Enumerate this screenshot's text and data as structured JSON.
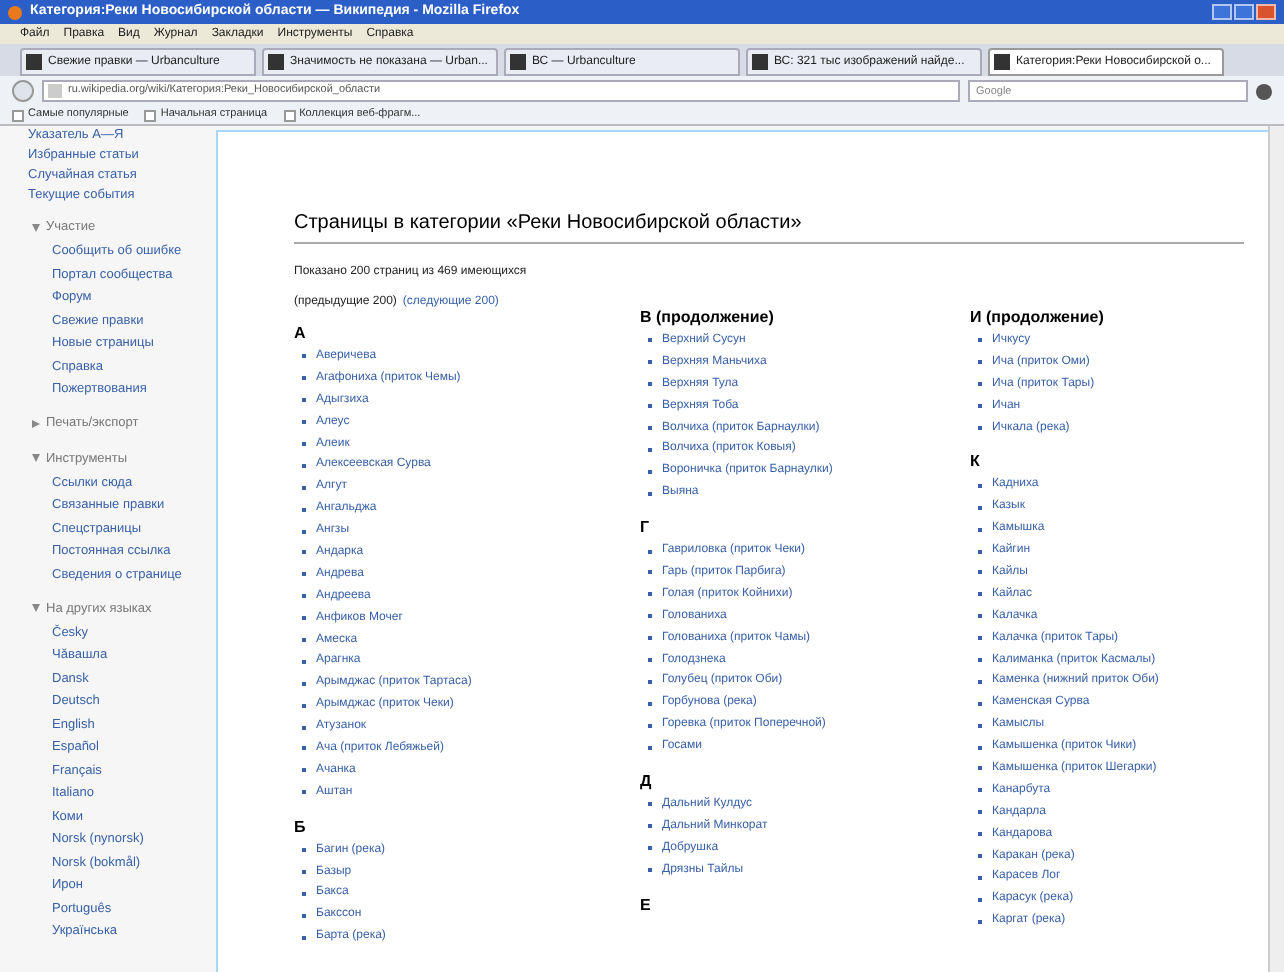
{
  "window": {
    "title": "Категория:Реки Новосибирской области — Википедия - Mozilla Firefox"
  },
  "menu": [
    "Файл",
    "Правка",
    "Вид",
    "Журнал",
    "Закладки",
    "Инструменты",
    "Справка"
  ],
  "tabs": [
    {
      "label": "Свежие правки — Urbanculture",
      "selected": false
    },
    {
      "label": "Значимость не показана — Urban...",
      "selected": false
    },
    {
      "label": "ВС — Urbanculture",
      "selected": false
    },
    {
      "label": "ВС: 321 тыс изображений найде...",
      "selected": false
    },
    {
      "label": "Категория:Реки Новосибирской о...",
      "selected": true
    }
  ],
  "address_bar": {
    "value": "ru.wikipedia.org/wiki/Категория:Реки_Новосибирской_области"
  },
  "search": {
    "placeholder": "Google"
  },
  "bookmarks": [
    "Самые популярные",
    "Начальная страница",
    "Коллекция веб-фрагм..."
  ],
  "sidebar": {
    "links": [
      "Указатель А—Я",
      "Избранные статьи",
      "Случайная статья",
      "Текущие события"
    ],
    "sections": [
      {
        "title": "Участие",
        "expanded": true,
        "items": [
          "Сообщить об ошибке",
          "Портал сообщества",
          "Форум",
          "Свежие правки",
          "Новые страницы",
          "Справка",
          "Пожертвования"
        ]
      },
      {
        "title": "Печать/экспорт",
        "expanded": false
      },
      {
        "title": "Инструменты",
        "expanded": true,
        "items": [
          "Ссылки сюда",
          "Связанные правки",
          "Спецстраницы",
          "Постоянная ссылка",
          "Сведения о странице"
        ]
      },
      {
        "title": "На других языках",
        "expanded": true,
        "items": [
          "Česky",
          "Чăвашла",
          "Dansk",
          "Deutsch",
          "English",
          "Español",
          "Français",
          "Italiano",
          "Коми",
          "Norsk (nynorsk)",
          "Norsk (bokmål)",
          "Ирон",
          "Português",
          "Українська"
        ]
      }
    ]
  },
  "content": {
    "heading": "Страницы в категории «Реки Новосибирской области»",
    "summary": "Показано 200 страниц из 469 имеющихся",
    "prev": "(предыдущие 200)",
    "next": "(следующие 200)",
    "columns": [
      [
        {
          "letter": "А",
          "items": [
            "Аверичева",
            "Агафониха (приток Чемы)",
            "Адыгзиха",
            "Алеус",
            "Алеик",
            "Алексеевская Сурва",
            "Алгут",
            "Ангальджа",
            "Ангзы",
            "Андарка",
            "Андрева",
            "Андреева",
            "Анфиков Мочег",
            "Амеска",
            "Арагнка",
            "Арымджас (приток Тартаса)",
            "Арымджас (приток Чеки)",
            "Атузанок",
            "Ача (приток Лебяжьей)",
            "Ачанка",
            "Аштан"
          ]
        },
        {
          "letter": "Б",
          "items": [
            "Багин (река)",
            "Базыр",
            "Бакса",
            "Бакссон",
            "Барта (река)"
          ]
        }
      ],
      [
        {
          "letter": "В (продолжение)",
          "items": [
            "Верхний Сусун",
            "Верхняя Маньчиха",
            "Верхняя Тула",
            "Верхняя Тоба",
            "Волчиха (приток Барнаулки)",
            "Волчиха (приток Ковыя)",
            "Вороничка (приток Барнаулки)",
            "Выяна"
          ]
        },
        {
          "letter": "Г",
          "items": [
            "Гавриловка (приток Чеки)",
            "Гарь (приток Парбига)",
            "Голая (приток Койнихи)",
            "Голованиха",
            "Голованиха (приток Чамы)",
            "Голодзнека",
            "Голубец (приток Оби)",
            "Горбунова (река)",
            "Горевка (приток Поперечной)",
            "Госами"
          ]
        },
        {
          "letter": "Д",
          "items": [
            "Дальний Кулдус",
            "Дальний Минкорат",
            "Добрушка",
            "Дрязны Тайлы"
          ]
        },
        {
          "letter": "Е"
        }
      ],
      [
        {
          "letter": "И (продолжение)",
          "items": [
            "Ичкусу",
            "Ича (приток Оми)",
            "Ича (приток Тары)",
            "Ичан",
            "Ичкала (река)"
          ]
        },
        {
          "letter": "К",
          "items": [
            "Кадниха",
            "Казык",
            "Камышка",
            "Кайгин",
            "Кайлы",
            "Кайлас",
            "Калачка",
            "Калачка (приток Тары)",
            "Калиманка (приток Касмалы)",
            "Каменка (нижний приток Оби)",
            "Каменская Сурва",
            "Камыслы",
            "Камышенка (приток Чики)",
            "Камышенка (приток Шегарки)",
            "Канарбута",
            "Кандарла",
            "Кандарова",
            "Каракан (река)",
            "Карасев Лог",
            "Карасук (река)",
            "Каргат (река)"
          ]
        }
      ]
    ]
  }
}
